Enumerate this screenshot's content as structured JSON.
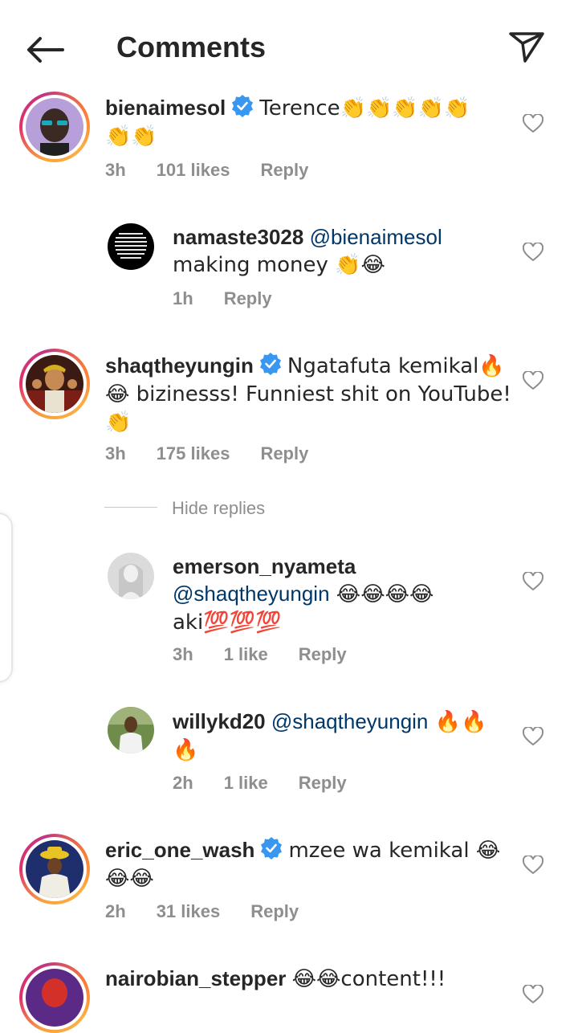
{
  "header": {
    "title": "Comments"
  },
  "colors": {
    "mention": "#00376b",
    "meta": "#8e8e8e",
    "verified": "#3897f0"
  },
  "icons": [
    "back-arrow-icon",
    "share-icon",
    "heart-icon",
    "verified-icon"
  ],
  "comments": [
    {
      "username": "bienaimesol",
      "text_line1": "Terence👏👏👏👏👏",
      "text_line2": "👏👏",
      "time": "3h",
      "likes": "101 likes",
      "reply": "Reply"
    },
    {
      "username": "namaste3028",
      "mention": "@bienaimesol",
      "text_line2": "making money 👏😂",
      "time": "1h",
      "reply": "Reply"
    },
    {
      "username": "shaqtheyungin",
      "text_line1": "Ngatafuta kemikal🔥",
      "text_line2": "😂 bizinesss! Funniest shit on YouTube!",
      "text_line3": "👏",
      "time": "3h",
      "likes": "175 likes",
      "reply": "Reply"
    },
    {
      "hide_replies": "Hide replies"
    },
    {
      "username": "emerson_nyameta",
      "mention": "@shaqtheyungin",
      "text_line2_rest": " 😂😂😂😂",
      "text_line3": "aki💯💯💯",
      "time": "3h",
      "likes": "1 like",
      "reply": "Reply"
    },
    {
      "username": "willykd20",
      "mention": "@shaqtheyungin",
      "text_line1_rest": " 🔥🔥",
      "text_line2": "🔥",
      "time": "2h",
      "likes": "1 like",
      "reply": "Reply"
    },
    {
      "username": "eric_one_wash",
      "text_line1": "mzee wa kemikal 😂",
      "text_line2": "😂😂",
      "time": "2h",
      "likes": "31 likes",
      "reply": "Reply"
    },
    {
      "username": "nairobian_stepper",
      "text_line1": "😂😂content!!!"
    }
  ]
}
